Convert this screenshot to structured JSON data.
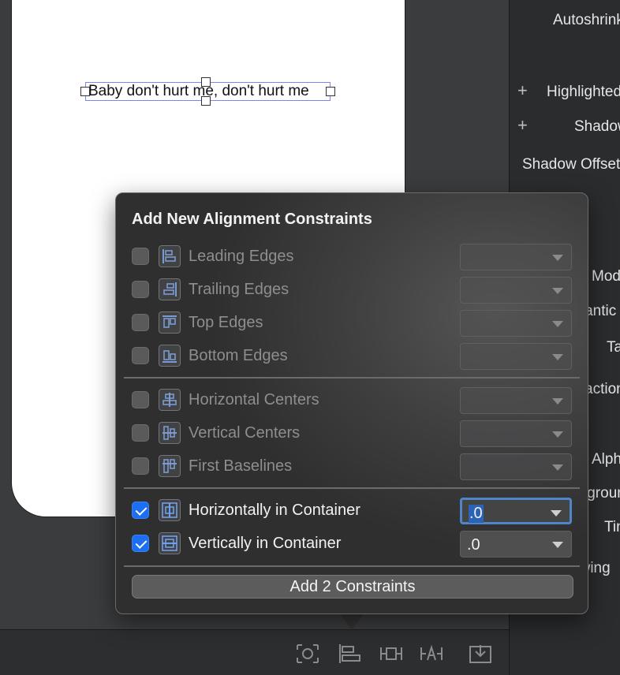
{
  "canvas": {
    "label_text": "Baby don't hurt me, don't hurt me"
  },
  "inspector": {
    "items": [
      {
        "label": "Autoshrink"
      },
      {
        "label": "Highlighted"
      },
      {
        "label": "Shadow"
      },
      {
        "label": "Shadow Offset"
      },
      {
        "label": "Mode"
      },
      {
        "label": "Semantic"
      },
      {
        "label": "Tag"
      },
      {
        "label": "Interaction"
      },
      {
        "label": "Alpha"
      },
      {
        "label": "Background"
      },
      {
        "label": "Tint"
      },
      {
        "label": "Drawing"
      }
    ]
  },
  "popover": {
    "title": "Add New Alignment Constraints",
    "edges": [
      {
        "label": "Leading Edges",
        "checked": false,
        "icon": "leading-edges-icon"
      },
      {
        "label": "Trailing Edges",
        "checked": false,
        "icon": "trailing-edges-icon"
      },
      {
        "label": "Top Edges",
        "checked": false,
        "icon": "top-edges-icon"
      },
      {
        "label": "Bottom Edges",
        "checked": false,
        "icon": "bottom-edges-icon"
      }
    ],
    "centers": [
      {
        "label": "Horizontal Centers",
        "checked": false,
        "icon": "horizontal-centers-icon"
      },
      {
        "label": "Vertical Centers",
        "checked": false,
        "icon": "vertical-centers-icon"
      },
      {
        "label": "First Baselines",
        "checked": false,
        "icon": "first-baselines-icon"
      }
    ],
    "container": [
      {
        "label": "Horizontally in Container",
        "checked": true,
        "value": ".0",
        "icon": "horizontally-in-container-icon"
      },
      {
        "label": "Vertically in Container",
        "checked": true,
        "value": ".0",
        "icon": "vertically-in-container-icon"
      }
    ],
    "add_button": "Add 2 Constraints"
  },
  "toolbar": {
    "icons": [
      "update-frames-icon",
      "align-icon",
      "add-new-constraints-icon",
      "resolve-autolayout-icon",
      "embed-in-icon"
    ]
  },
  "colors": {
    "accent": "#1c6ef2",
    "focus_ring": "#4f86c9",
    "selection_outline": "#7a86ee"
  }
}
